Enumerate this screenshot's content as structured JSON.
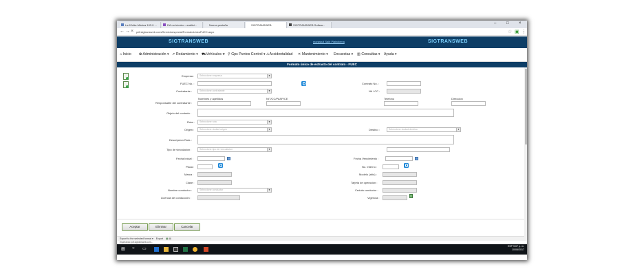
{
  "browser": {
    "tabs": [
      "La 8 Más Música 103.9 ...",
      "DA no técnico - análisi...",
      "Nueva pestaña",
      "SIGTRANSWEB",
      "SIGTRANSWEB Softwa..."
    ],
    "url": "pdf.sigtransweb.com/Servicioespecial/FormatoUnicoFUEC.aspx",
    "window_controls": [
      "–",
      "□",
      "×"
    ]
  },
  "banner": {
    "brand_left": "SIGTRANSWEB",
    "brand_right": "SIGTRANSWEB",
    "link": "morastuil Salir Plataforma"
  },
  "menu": [
    "Inicio",
    "Administración ▾",
    "Rodamiento ▾",
    "Vehículos ▾",
    "Gps Puntos Control ▾",
    "Accidentalidad",
    "Mantenimiento ▾",
    "Encuestas ▾",
    "Consultas ▾",
    "Ayuda ▾"
  ],
  "form": {
    "title": "Formato único de extracto del contrato - FUEC",
    "labels": {
      "empresa": "Empresa :",
      "fuec_no": "FUEC No. :",
      "contrato_no": "Contrato No. :",
      "contratante": "Contratante :",
      "nit": "Nit / CC :",
      "responsable": "Responsable del contratante :",
      "nombres": "Nombres y apellidos",
      "nitcc": "NIT/CC/PASP/CE",
      "telefono": "Telefono",
      "direccion": "Direccion",
      "objeto": "Objeto del contrato :",
      "ruta": "Ruta :",
      "origen": "Origen :",
      "destino": "Destino :",
      "descripcion": "Descripcion Ruta :",
      "tipo": "Tipo de vinculacion :",
      "fecha_inicial": "Fecha Inicial :",
      "fecha_venc": "Fecha Vencimiento :",
      "placa": "Placa :",
      "no_interno": "No. Interno :",
      "marca": "Marca :",
      "modelo": "Modelo (año) :",
      "clase": "Clase :",
      "tarjeta": "Tarjeta de operación :",
      "nombre_conductor": "Nombre conductor :",
      "cedula": "Cedula conductor :",
      "licencia": "Licencia de conducción :",
      "vigencia": "Vigencia :"
    },
    "placeholders": {
      "empresa": "Seleccione empresa",
      "contratante": "Seleccione contratante",
      "ruta": "Seleccione ruta",
      "origen": "Seleccione ciudad origen",
      "destino": "Seleccione ciudad destino",
      "tipo": "Seleccione tipo de vinculacion",
      "conductor": "Seleccione conductor"
    }
  },
  "buttons": {
    "aceptar": "Aceptar",
    "eliminar": "Eliminar",
    "cancelar": "Cancelar"
  },
  "export": {
    "select": "Export to the selected format ▾",
    "label": "Export"
  },
  "status": "Esperando pdf.sigtransweb.com...",
  "clock": {
    "time": "9:07 p. m.",
    "date": "10/06/2017",
    "lang": "ESP"
  }
}
